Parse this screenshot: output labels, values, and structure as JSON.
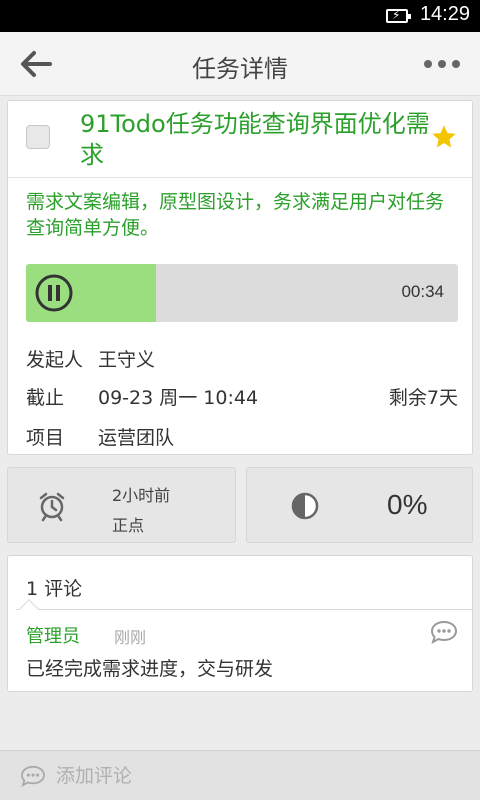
{
  "status_bar": {
    "time": "14:29",
    "battery_icon": "battery-charging-icon"
  },
  "header": {
    "title": "任务详情",
    "back_icon": "back-arrow-icon",
    "more_icon": "more-dots-icon"
  },
  "task": {
    "completed": false,
    "title": "91Todo任务功能查询界面优化需求",
    "starred": true,
    "description": "需求文案编辑，原型图设计，务求满足用户对任务查询简单方便。",
    "audio": {
      "duration": "00:34",
      "progress_fraction": 0.3,
      "state": "playing"
    },
    "initiator_label": "发起人",
    "initiator": "王守义",
    "deadline_label": "截止",
    "deadline": "09-23 周一 10:44",
    "remaining": "剩余7天",
    "project_label": "项目",
    "project": "运营团队"
  },
  "stats": {
    "reminder_ago": "2小时前",
    "reminder_mode": "正点",
    "progress": "0%"
  },
  "comments": {
    "header": "1 评论",
    "items": [
      {
        "author": "管理员",
        "time": "刚刚",
        "text": "已经完成需求进度，交与研发"
      }
    ]
  },
  "footer": {
    "placeholder": "添加评论"
  },
  "colors": {
    "accent_green": "#2ba02b",
    "progress_fill": "#9bde80",
    "star": "#f5c400"
  }
}
